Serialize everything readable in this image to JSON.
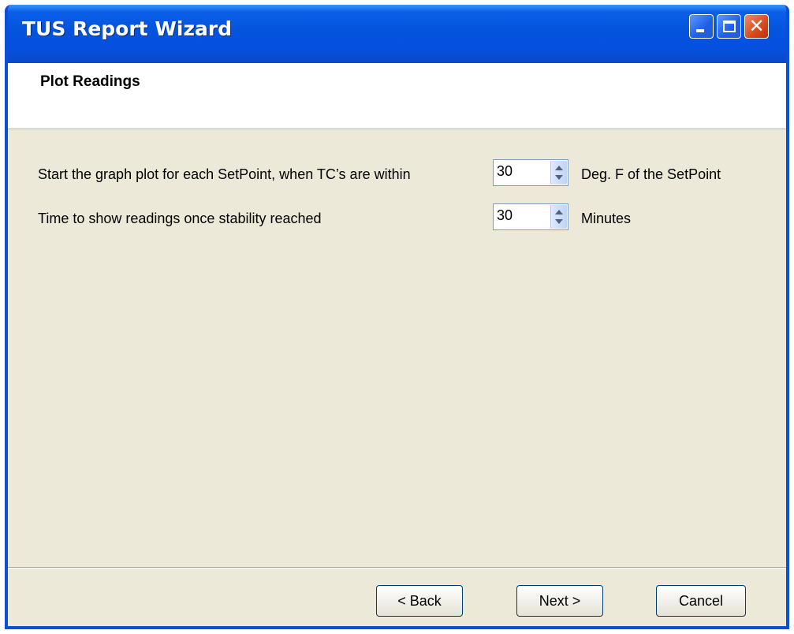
{
  "window": {
    "title": "TUS Report Wizard"
  },
  "header": {
    "title": "Plot Readings"
  },
  "settings": {
    "start_plot": {
      "label": "Start the graph plot for each SetPoint, when TC’s are within",
      "value": "30",
      "unit": "Deg. F of the SetPoint"
    },
    "time_readings": {
      "label": "Time to show readings once stability reached",
      "value": "30",
      "unit": "Minutes"
    }
  },
  "buttons": {
    "back": "< Back",
    "next": "Next >",
    "cancel": "Cancel"
  },
  "icons": {
    "minimize": "minimize-icon",
    "maximize": "maximize-icon",
    "close": "close-icon",
    "spin_up": "chevron-up-icon",
    "spin_down": "chevron-down-icon"
  },
  "colors": {
    "titlebar": "#0453dd",
    "close_button": "#d8481c",
    "dialog_background": "#ece9d8"
  }
}
